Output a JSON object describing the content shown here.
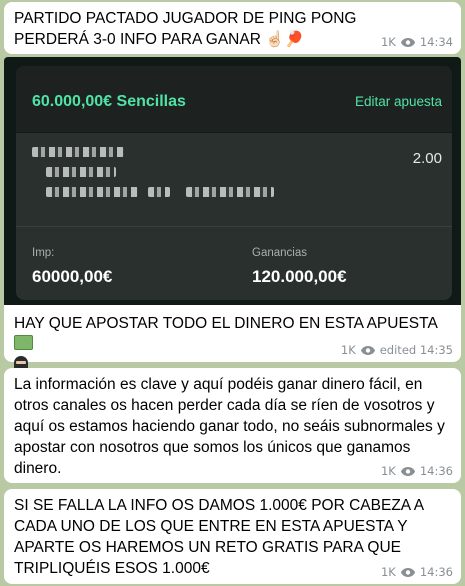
{
  "messages": [
    {
      "text": "PARTIDO PACTADO JUGADOR DE PING PONG PERDERÁ 3-0 INFO PARA GANAR ☝🏻🏓",
      "views": "1K",
      "time": "14:34"
    },
    {
      "bet_card": {
        "stake_title": "60.000,00€  Sencillas",
        "edit_label": "Editar apuesta",
        "odds": "2.00",
        "stake_label": "Imp:",
        "stake_value": "60000,00€",
        "winnings_label": "Ganancias",
        "winnings_value": "120.000,00€"
      },
      "text": "HAY QUE APOSTAR TODO EL DINERO EN ESTA APUESTA",
      "views": "1K",
      "time": "edited 14:35"
    },
    {
      "text": "La información es clave y aquí podéis ganar dinero fácil, en otros canales os hacen perder cada día se ríen de vosotros y aquí os estamos haciendo ganar todo, no seáis subnormales y apostar con nosotros que somos los únicos que ganamos dinero.",
      "views": "1K",
      "time": "14:36"
    },
    {
      "text": "SI SE FALLA LA INFO OS DAMOS 1.000€ POR CABEZA A CADA UNO DE LOS QUE ENTRE EN ESTA APUESTA Y APARTE OS HAREMOS UN RETO GRATIS PARA QUE TRIPLIQUÉIS ESOS 1.000€",
      "views": "1K",
      "time": "14:36"
    }
  ],
  "icons": {
    "views": "eye-icon",
    "money": "money-bag-icon",
    "ninja": "ninja-icon"
  },
  "colors": {
    "chat_background": "#b8c9a3",
    "bubble": "#ffffff",
    "accent_green": "#4fe3a6",
    "meta_gray": "#8a8f94"
  }
}
